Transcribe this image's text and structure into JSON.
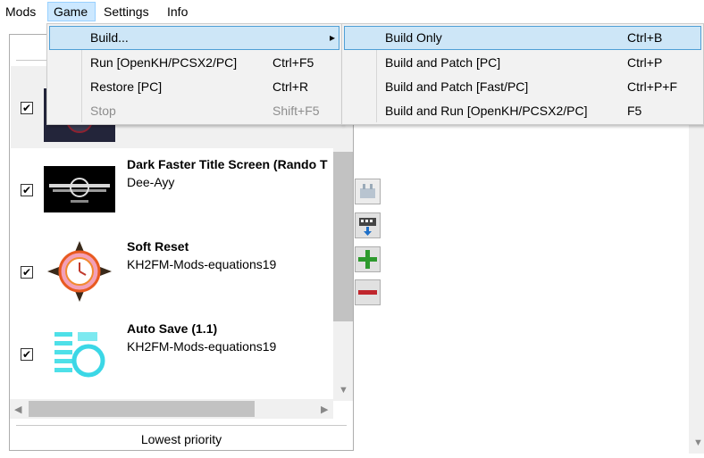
{
  "menubar": {
    "items": [
      {
        "label": "Mods"
      },
      {
        "label": "Game"
      },
      {
        "label": "Settings"
      },
      {
        "label": "Info"
      }
    ]
  },
  "game_menu": {
    "items": [
      {
        "label": "Build...",
        "shortcut": ""
      },
      {
        "label": "Run [OpenKH/PCSX2/PC]",
        "shortcut": "Ctrl+F5"
      },
      {
        "label": "Restore [PC]",
        "shortcut": "Ctrl+R"
      },
      {
        "label": "Stop",
        "shortcut": "Shift+F5"
      }
    ],
    "submenu_arrow": "▸"
  },
  "build_submenu": {
    "items": [
      {
        "label": "Build Only",
        "shortcut": "Ctrl+B"
      },
      {
        "label": "Build and Patch [PC]",
        "shortcut": "Ctrl+P"
      },
      {
        "label": "Build and Patch [Fast/PC]",
        "shortcut": "Ctrl+P+F"
      },
      {
        "label": "Build and Run [OpenKH/PCSX2/PC]",
        "shortcut": "F5"
      }
    ]
  },
  "mods": [
    {
      "title": "",
      "author": "",
      "checked": true
    },
    {
      "title": "Dark Faster Title Screen (Rando T",
      "author": "Dee-Ayy",
      "checked": true
    },
    {
      "title": "Soft Reset",
      "author": "KH2FM-Mods-equations19",
      "checked": true
    },
    {
      "title": "Auto Save (1.1)",
      "author": "KH2FM-Mods-equations19",
      "checked": true
    }
  ],
  "checkmark": "✔",
  "priority_label": "Lowest priority",
  "side_buttons": [
    "mod-icon",
    "build-icon",
    "add-icon",
    "remove-icon"
  ],
  "colors": {
    "menu_highlight": "#cde6f7",
    "menubar_active": "#cce8ff",
    "add_green": "#2e9a2e",
    "remove_red": "#c0262d"
  }
}
